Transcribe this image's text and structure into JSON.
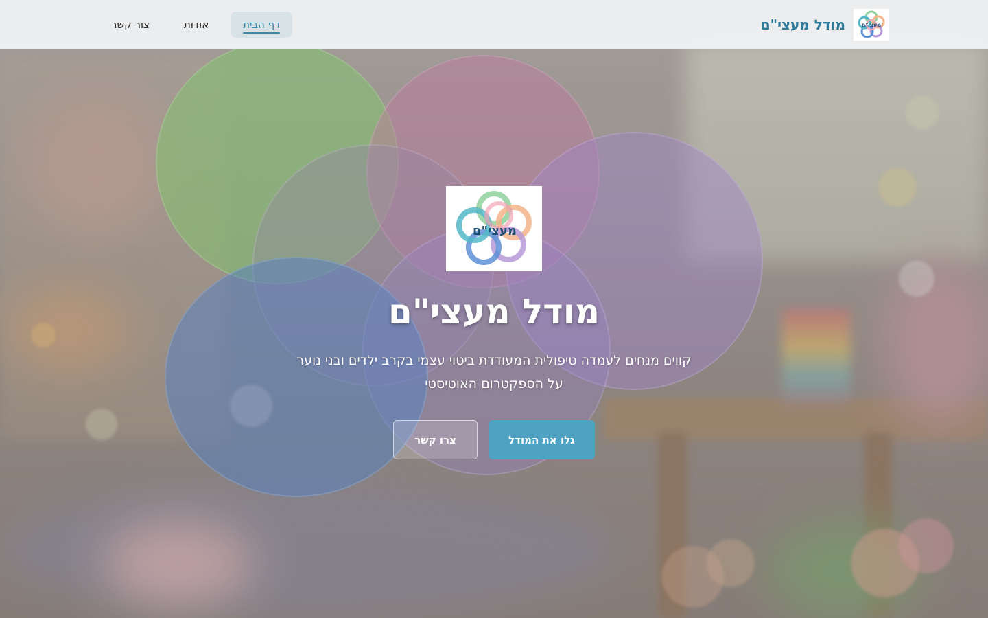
{
  "header": {
    "brand_name": "מודל מעצי\"ם",
    "logo_text": "מעצי\"ם",
    "nav": [
      {
        "label": "דף הבית",
        "active": true
      },
      {
        "label": "אודות",
        "active": false
      },
      {
        "label": "צור קשר",
        "active": false
      }
    ]
  },
  "hero": {
    "logo_text": "מעצי\"ם",
    "title": "מודל מעצי\"ם",
    "subtitle": "קווים מנחים לעמדה טיפולית המעודדת ביטוי עצמי בקרב ילדים ובני נוער על הספקטרום האוטיסטי",
    "primary_button": "גלו את המודל",
    "secondary_button": "צרו קשר"
  },
  "colors": {
    "accent": "#4fa2c1",
    "brand_text": "#2f7a98",
    "header_bg": "#eef0f2",
    "logo_ring_green": "#8fd19e",
    "logo_ring_pink": "#f3a3b5",
    "logo_ring_orange": "#f5b48a",
    "logo_ring_purple": "#b69ad8",
    "logo_ring_blue": "#5e8fd6",
    "logo_ring_teal": "#55b8c8"
  }
}
